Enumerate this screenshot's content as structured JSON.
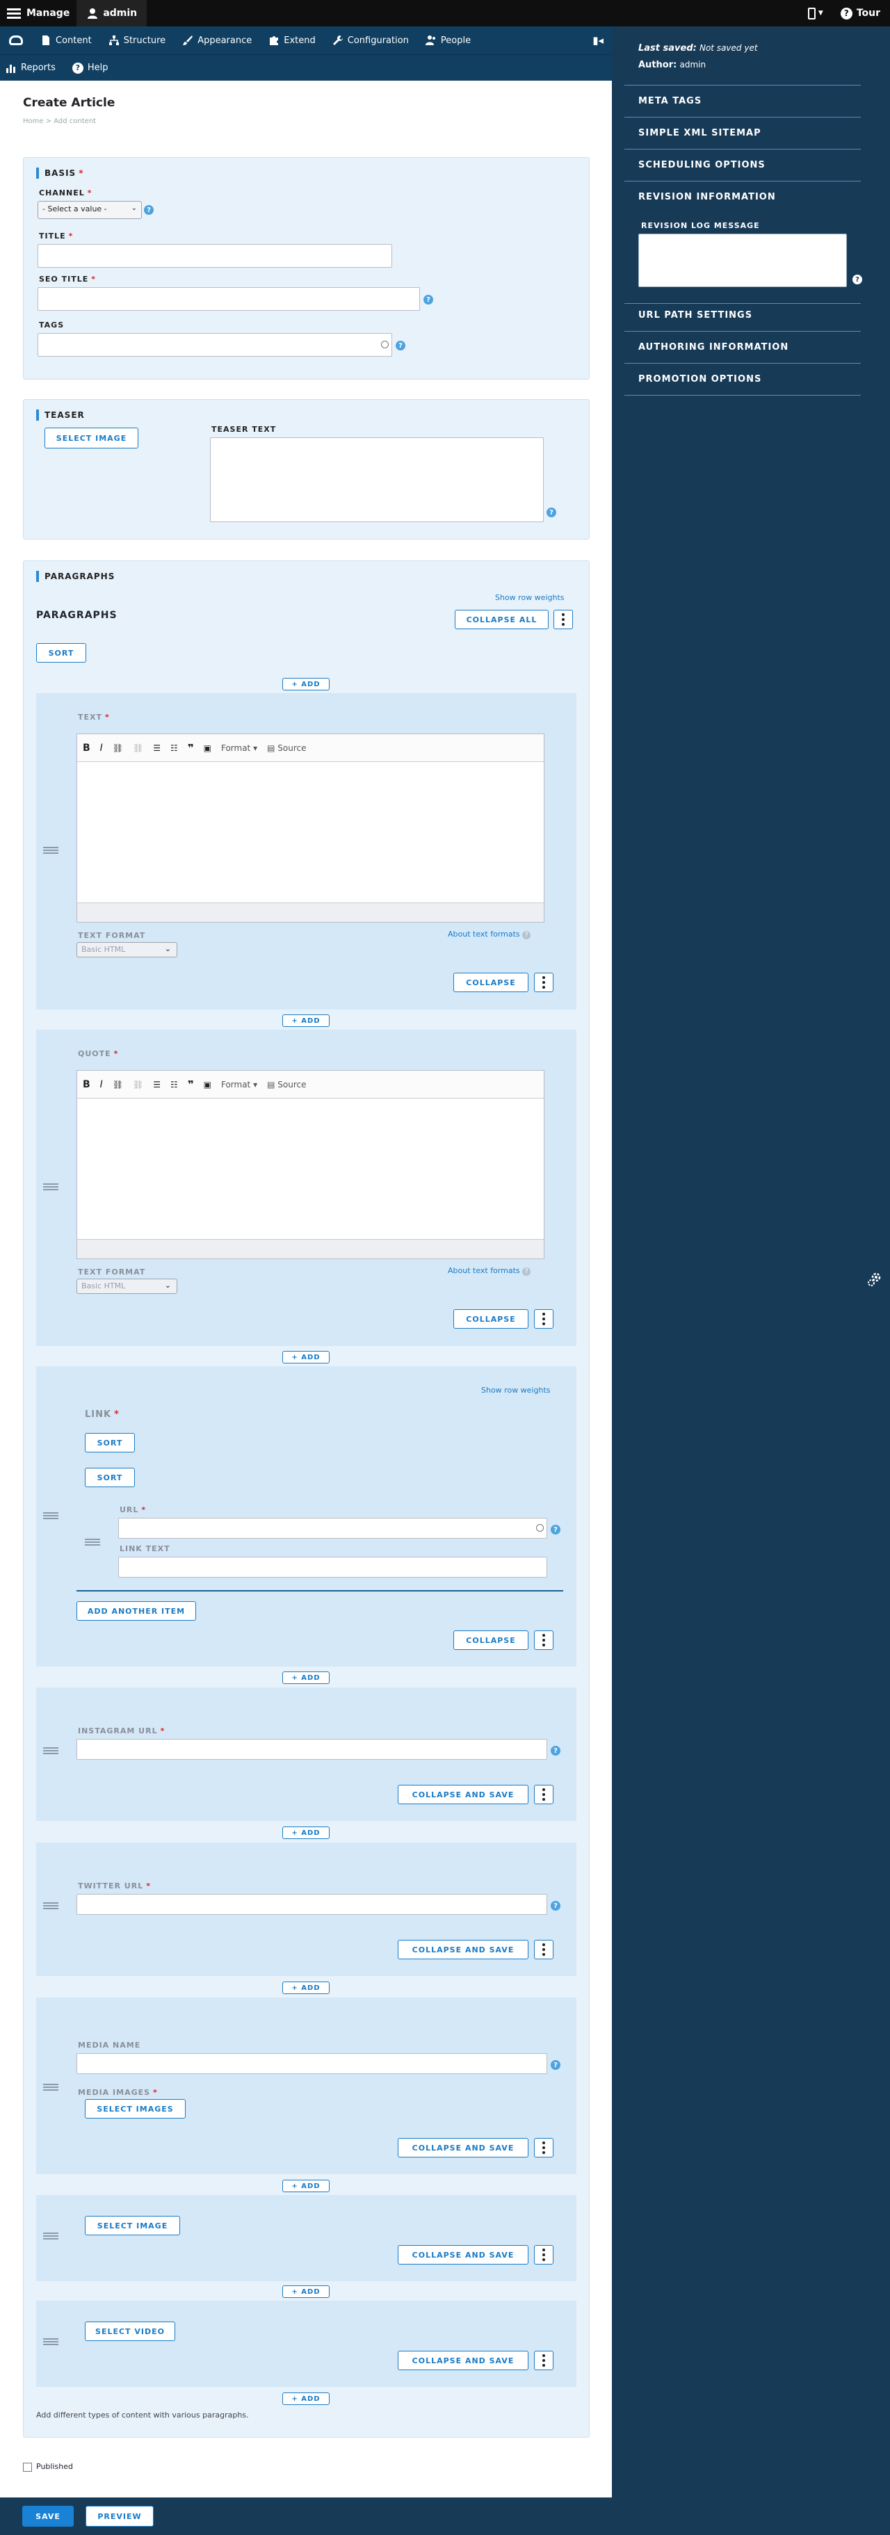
{
  "toolbar": {
    "manage": "Manage",
    "user": "admin",
    "tour": "Tour"
  },
  "tray": {
    "items": [
      "Content",
      "Structure",
      "Appearance",
      "Extend",
      "Configuration",
      "People"
    ],
    "items2": [
      "Reports",
      "Help"
    ]
  },
  "page": {
    "title": "Create Article",
    "breadcrumb": "Home > Add content"
  },
  "basis": {
    "legend": "BASIS",
    "channel_label": "CHANNEL",
    "channel_value": "- Select a value -",
    "title_label": "TITLE",
    "seo_title_label": "SEO TITLE",
    "tags_label": "TAGS"
  },
  "teaser": {
    "legend": "TEASER",
    "select_image": "SELECT IMAGE",
    "teaser_text_label": "TEASER TEXT"
  },
  "paragraphs": {
    "legend": "PARAGRAPHS",
    "show_row_weights": "Show row weights",
    "heading": "PARAGRAPHS",
    "collapse_all": "COLLAPSE ALL",
    "sort": "SORT",
    "add": "+ ADD",
    "text_label": "TEXT",
    "quote_label": "QUOTE",
    "text_format_label": "TEXT FORMAT",
    "text_format_value": "Basic HTML",
    "about_formats": "About text formats",
    "collapse": "COLLAPSE",
    "editor_format": "Format",
    "editor_source": "Source",
    "link_label": "LINK",
    "url_label": "URL",
    "link_text_label": "LINK TEXT",
    "add_another_item": "ADD ANOTHER ITEM",
    "instagram_label": "INSTAGRAM URL",
    "twitter_label": "TWITTER URL",
    "collapse_and_save": "COLLAPSE AND SAVE",
    "media_name_label": "MEDIA NAME",
    "media_images_label": "MEDIA IMAGES",
    "select_images": "SELECT IMAGES",
    "select_image": "SELECT IMAGE",
    "select_video": "SELECT VIDEO",
    "description": "Add different types of content with various paragraphs."
  },
  "published_label": "Published",
  "actions": {
    "save": "SAVE",
    "preview": "PREVIEW"
  },
  "sidebar": {
    "last_saved_label": "Last saved:",
    "last_saved_value": "Not saved yet",
    "author_label": "Author:",
    "author_value": "admin",
    "sections": [
      "META TAGS",
      "SIMPLE XML SITEMAP",
      "SCHEDULING OPTIONS",
      "REVISION INFORMATION",
      "URL PATH SETTINGS",
      "AUTHORING INFORMATION",
      "PROMOTION OPTIONS"
    ],
    "revision_log_label": "REVISION LOG MESSAGE"
  },
  "colors": {
    "accent": "#1a7bc5",
    "sidebar": "#173a57",
    "toolbar": "#0f0f0f",
    "tray": "#103f61",
    "panel": "#e8f2fb"
  }
}
